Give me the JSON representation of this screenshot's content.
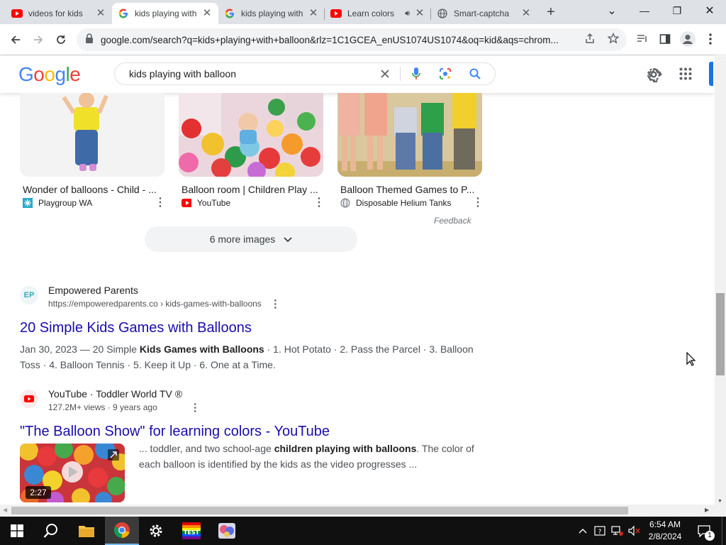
{
  "tabs": [
    {
      "title": "videos for kids",
      "favicon": "youtube-icon"
    },
    {
      "title": "kids playing with",
      "favicon": "google-icon",
      "active": true
    },
    {
      "title": "kids playing with",
      "favicon": "google-icon"
    },
    {
      "title": "Learn colors",
      "favicon": "youtube-icon",
      "audio": true
    },
    {
      "title": "Smart-captcha",
      "favicon": "globe-icon"
    }
  ],
  "window_controls": {
    "minimize": "—",
    "maximize": "❐",
    "close": "✕",
    "tab_search": "⌄"
  },
  "toolbar": {
    "url": "google.com/search?q=kids+playing+with+balloon&rlz=1C1GCEA_enUS1074US1074&oq=kid&aqs=chrom..."
  },
  "search": {
    "logo": "Google",
    "query": "kids playing with balloon"
  },
  "images": [
    {
      "title": "Wonder of balloons - Child - ...",
      "source": "Playgroup WA"
    },
    {
      "title": "Balloon room | Children Play ...",
      "source": "YouTube"
    },
    {
      "title": "Balloon Themed Games to P...",
      "source": "Disposable Helium Tanks"
    }
  ],
  "feedback": "Feedback",
  "more_images": "6 more images",
  "results": [
    {
      "site": "Empowered Parents",
      "cite": "https://empoweredparents.co › kids-games-with-balloons",
      "favicon_text": "EP",
      "title": "20 Simple Kids Games with Balloons",
      "snippet_a": "Jan 30, 2023 — 20 Simple ",
      "snippet_b": "Kids Games with Balloons",
      "snippet_c": " · 1. Hot Potato · 2. Pass the Parcel · 3. Balloon Toss · 4. Balloon Tennis · 5. Keep it Up · 6. One at a Time."
    },
    {
      "site": "YouTube · Toddler World TV ®",
      "cite": "127.2M+ views · 9 years ago",
      "title": "\"The Balloon Show\" for learning colors - YouTube",
      "snippet_a": "... toddler, and two school-age ",
      "snippet_b": "children playing with balloons",
      "snippet_c": ". The color of each balloon is identified by the kids as the video progresses ...",
      "duration": "2:27"
    }
  ],
  "taskbar": {
    "time": "6:54 AM",
    "date": "2/8/2024",
    "notifications": "1"
  }
}
